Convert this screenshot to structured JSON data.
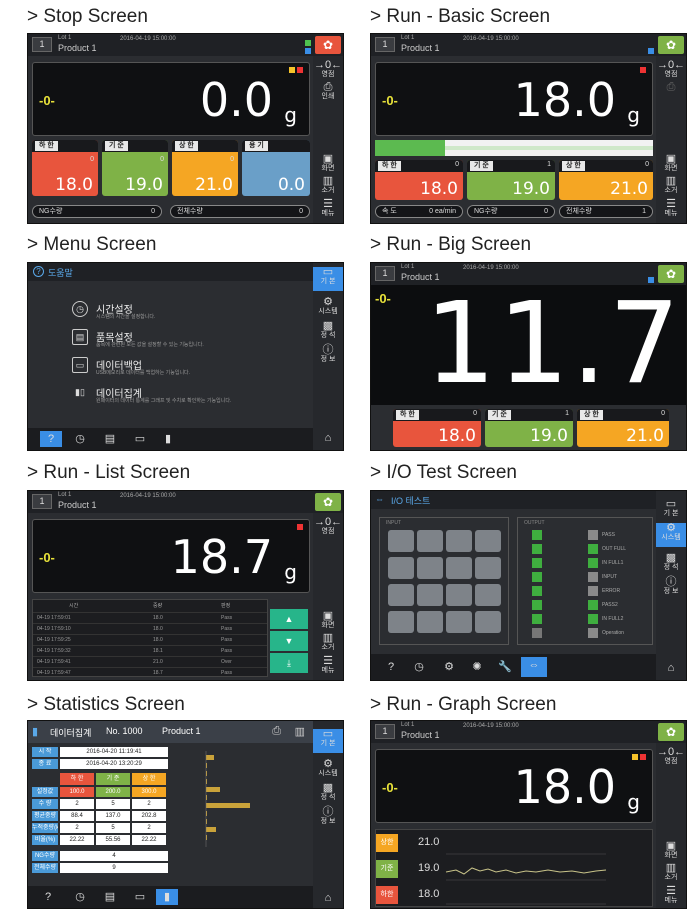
{
  "captions": [
    "> Stop Screen",
    "> Run - Basic Screen",
    "> Menu Screen",
    "> Run - Big Screen",
    "> Run - List Screen",
    "> I/O Test Screen",
    "> Statistics Screen",
    "> Run - Graph Screen"
  ],
  "common": {
    "lot": "Lot 1",
    "product": "Product 1",
    "num": "1",
    "zero": "-0-",
    "unit": "g",
    "date": "2016-04-19 15:00:00"
  },
  "side_labels": {
    "zero": "영점",
    "print": "인쇄",
    "view": "화면",
    "erase": "소거",
    "menu": "메뉴"
  },
  "colors": {
    "red": "#e8553d",
    "green": "#7fb247",
    "orange": "#f5a623",
    "blue": "#6a9fc8",
    "screen": "#2b2d31"
  },
  "stop": {
    "weight": "0.0",
    "lo_label": "하 한",
    "ref_label": "기 준",
    "hi_label": "상 한",
    "cap_label": "용 기",
    "lo": "18.0",
    "ref": "19.0",
    "hi": "21.0",
    "cap": "0.0",
    "sv": "0",
    "ng_label": "NG수량",
    "ng": "0",
    "total_label": "전체수량",
    "total": "0"
  },
  "basic": {
    "weight": "18.0",
    "lo": "18.0",
    "ref": "19.0",
    "hi": "21.0",
    "speed_label": "속 도",
    "speed": "0 ea/min",
    "ng_label": "NG수량",
    "ng": "0",
    "total_label": "전체수량",
    "total": "1",
    "ref_sv": "1",
    "progress": 0.25
  },
  "menu": {
    "title": "도움말",
    "items": [
      {
        "title": "시간설정",
        "sub": "시스템의 시간을 설정합니다."
      },
      {
        "title": "품목설정",
        "sub": "품목에 관련된 모든 값을 설정할 수 있는 기능입니다."
      },
      {
        "title": "데이터백업",
        "sub": "USB메모리로 데이터를 백업하는 기능입니다."
      },
      {
        "title": "데이터집계",
        "sub": "원패이터의 데이터 통계를 그래프 및 수치로 확인하는 기능입니다."
      }
    ],
    "side": [
      "기 본",
      "시스템",
      "정 석",
      "정 보"
    ]
  },
  "big": {
    "weight": "11.7",
    "lo": "18.0",
    "ref": "19.0",
    "hi": "21.0"
  },
  "list": {
    "weight": "18.7",
    "headers": [
      "시간",
      "중량",
      "판정"
    ],
    "rows": [
      [
        "04-19 17:59:01",
        "18.0",
        "Pass"
      ],
      [
        "04-19 17:59:10",
        "18.0",
        "Pass"
      ],
      [
        "04-19 17:59:25",
        "18.0",
        "Pass"
      ],
      [
        "04-19 17:59:32",
        "18.1",
        "Pass"
      ],
      [
        "04-19 17:59:41",
        "21.0",
        "Over"
      ],
      [
        "04-19 17:59:47",
        "18.7",
        "Pass"
      ]
    ]
  },
  "io": {
    "title": "I/O 테스트",
    "in_label": "INPUT",
    "out_label": "OUTPUT",
    "outs": [
      "PASS",
      "OUT FULL",
      "IN FULL1",
      "INPUT",
      "ERROR",
      "PASS2",
      "IN FULL2",
      "Operation"
    ]
  },
  "stats": {
    "title": "데이터집계",
    "no": "No. 1000",
    "product": "Product 1",
    "start_label": "시 작",
    "start": "2016-04-20 11:19:41",
    "end_label": "종 료",
    "end": "2016-04-20 13:20:29",
    "heads": [
      "하 한",
      "기 준",
      "상 한"
    ],
    "set_label": "설정값",
    "set": [
      "100.0",
      "200.0",
      "300.0"
    ],
    "rows": [
      {
        "label": "수 량",
        "v": [
          "2",
          "5",
          "2"
        ]
      },
      {
        "label": "평균중량",
        "v": [
          "88.4",
          "137.0",
          "202.8"
        ]
      },
      {
        "label": "누적중량(kg)",
        "v": [
          "2",
          "5",
          "2"
        ]
      },
      {
        "label": "비율(%)",
        "v": [
          "22.22",
          "55.56",
          "22.22"
        ]
      }
    ],
    "ng_label": "NG수량",
    "ng": "4",
    "total_label": "전체수량",
    "total": "9"
  },
  "graph": {
    "weight": "18.0",
    "hi": "21.0",
    "ref": "19.0",
    "lo": "18.0",
    "hi_label": "상한",
    "ref_label": "기준",
    "lo_label": "하한"
  }
}
